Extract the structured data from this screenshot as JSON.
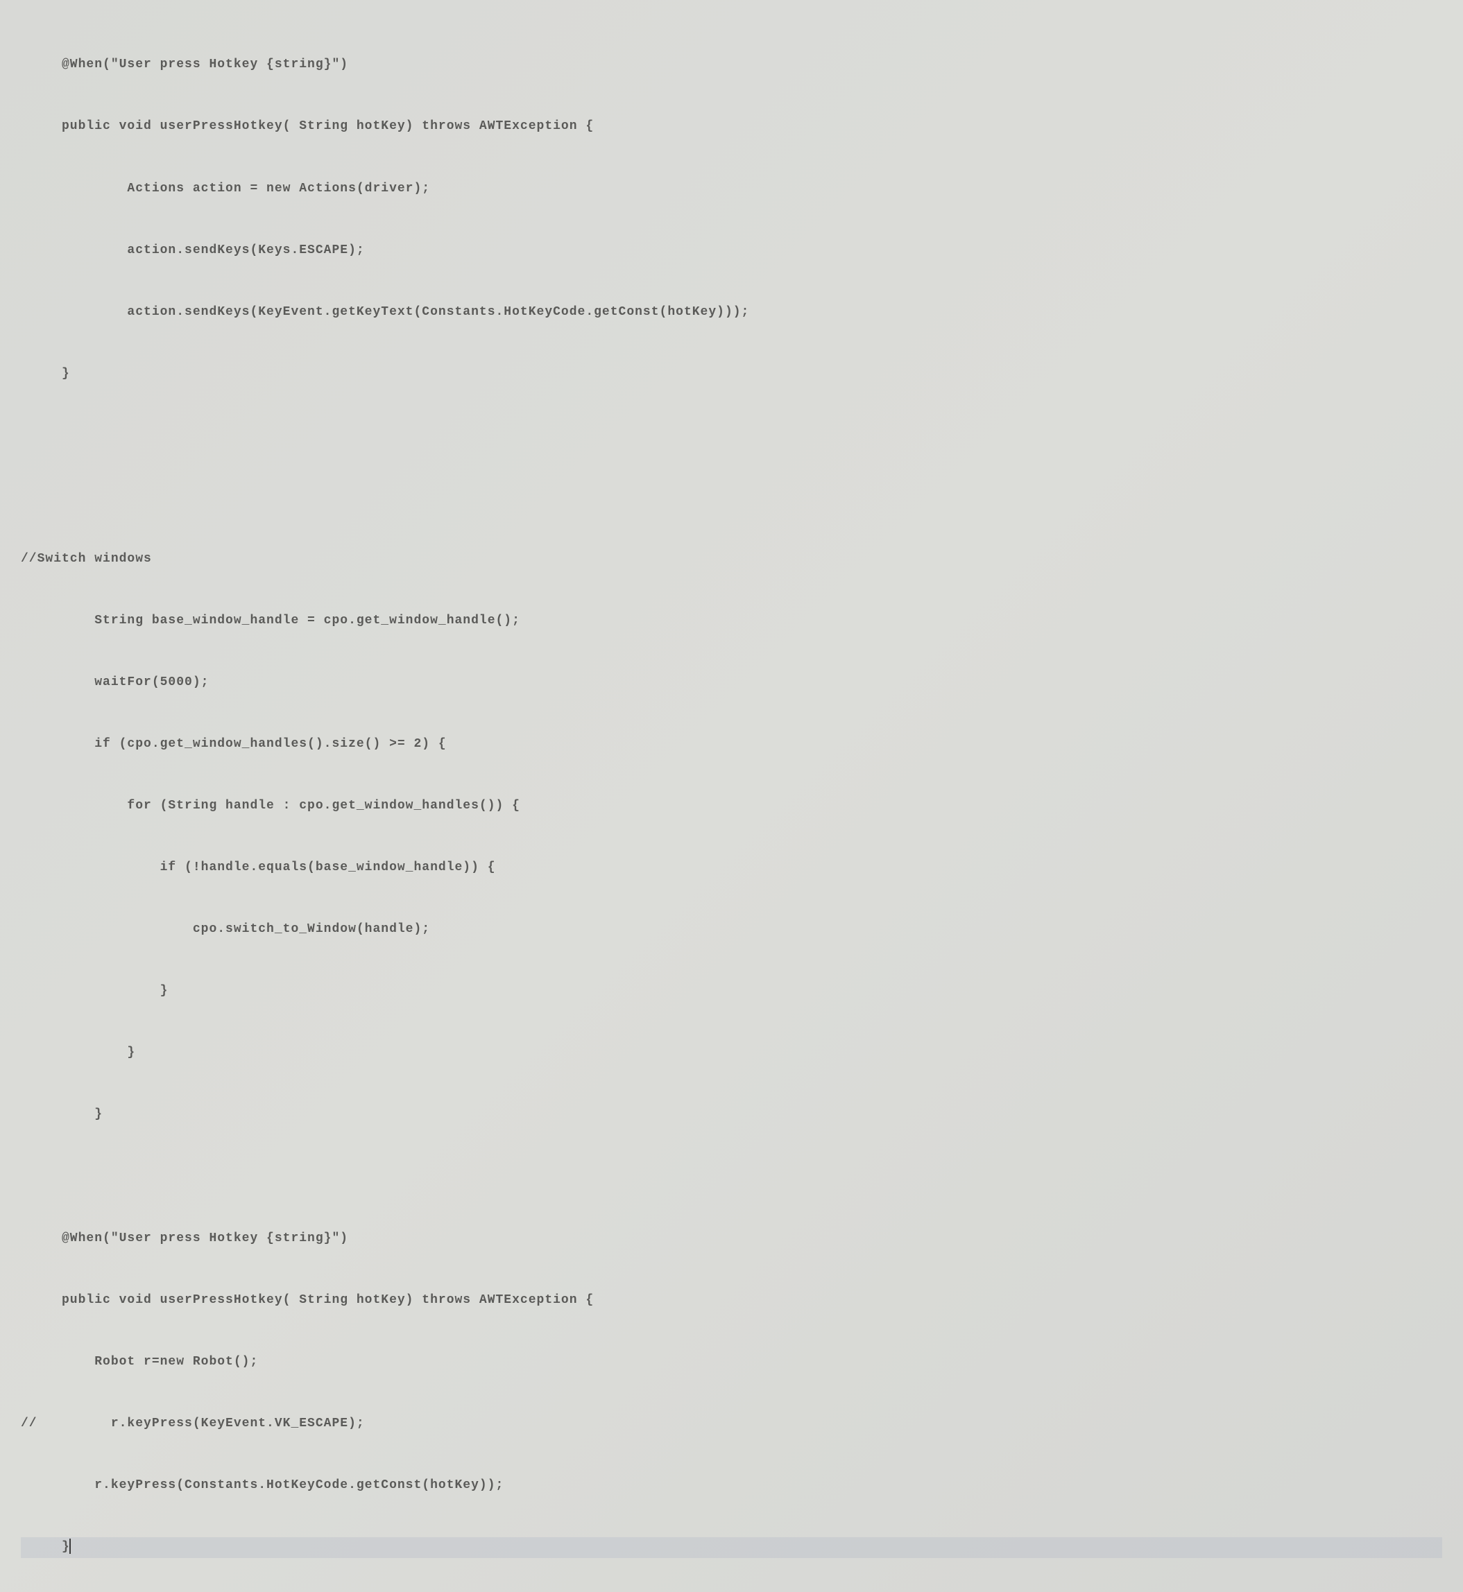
{
  "code": {
    "lines": [
      "     @When(\"User press Hotkey {string}\")",
      "     public void userPressHotkey( String hotKey) throws AWTException {",
      "             Actions action = new Actions(driver);",
      "             action.sendKeys(Keys.ESCAPE);",
      "             action.sendKeys(KeyEvent.getKeyText(Constants.HotKeyCode.getConst(hotKey)));",
      "     }",
      "",
      "",
      "//Switch windows",
      "         String base_window_handle = cpo.get_window_handle();",
      "         waitFor(5000);",
      "         if (cpo.get_window_handles().size() >= 2) {",
      "             for (String handle : cpo.get_window_handles()) {",
      "                 if (!handle.equals(base_window_handle)) {",
      "                     cpo.switch_to_Window(handle);",
      "                 }",
      "             }",
      "         }",
      "",
      "     @When(\"User press Hotkey {string}\")",
      "     public void userPressHotkey( String hotKey) throws AWTException {",
      "         Robot r=new Robot();",
      "//         r.keyPress(KeyEvent.VK_ESCAPE);",
      "         r.keyPress(Constants.HotKeyCode.getConst(hotKey));",
      "     }"
    ]
  }
}
